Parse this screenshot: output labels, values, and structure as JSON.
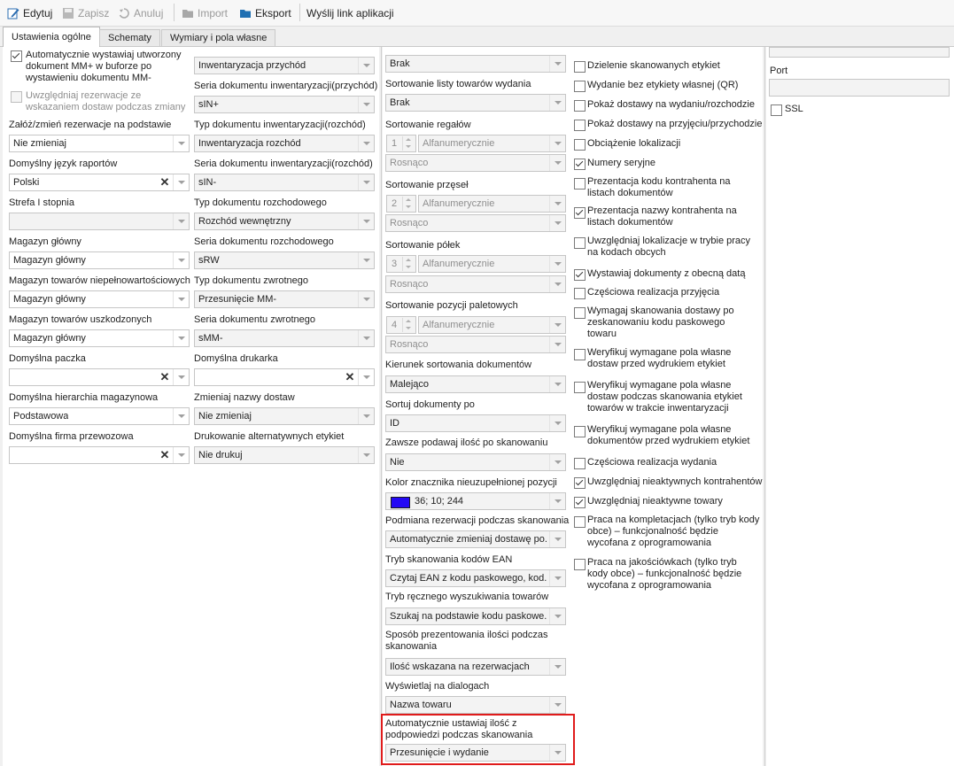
{
  "toolbar": {
    "edit": "Edytuj",
    "save": "Zapisz",
    "cancel": "Anuluj",
    "import": "Import",
    "export": "Eksport",
    "send_link": "Wyślij link aplikacji"
  },
  "tabs": [
    "Ustawienia ogólne",
    "Schematy",
    "Wymiary i pola własne"
  ],
  "col1": {
    "auto_mm_checkbox": "Automatycznie wystawiaj utworzony dokument MM+ w buforze po wystawieniu dokumentu MM-",
    "reservations_checkbox": "Uwzględniaj rezerwacje ze wskazaniem dostaw podczas zmiany",
    "fields": [
      {
        "label": "Załóż/zmień rezerwacje na podstawie",
        "value": "Nie zmieniaj"
      },
      {
        "label": "Domyślny język raportów",
        "value": "Polski"
      },
      {
        "label": "Strefa I stopnia",
        "value": ""
      },
      {
        "label": "Magazyn główny",
        "value": "Magazyn główny"
      },
      {
        "label": "Magazyn towarów niepełnowartościowych",
        "value": "Magazyn główny"
      },
      {
        "label": "Magazyn towarów uszkodzonych",
        "value": "Magazyn główny"
      },
      {
        "label": "Domyślna paczka",
        "value": ""
      },
      {
        "label": "Domyślna hierarchia magazynowa",
        "value": "Podstawowa"
      },
      {
        "label": "Domyślna firma przewozowa",
        "value": ""
      }
    ]
  },
  "col2": {
    "top_value": "Inwentaryzacja przychód",
    "fields": [
      {
        "label": "Seria dokumentu inwentaryzacji(przychód)",
        "value": "sIN+"
      },
      {
        "label": "Typ dokumentu inwentaryzacji(rozchód)",
        "value": "Inwentaryzacja rozchód"
      },
      {
        "label": "Seria dokumentu inwentaryzacji(rozchód)",
        "value": "sIN-"
      },
      {
        "label": "Typ dokumentu rozchodowego",
        "value": "Rozchód wewnętrzny"
      },
      {
        "label": "Seria dokumentu rozchodowego",
        "value": "sRW"
      },
      {
        "label": "Typ dokumentu zwrotnego",
        "value": "Przesunięcie MM-"
      },
      {
        "label": "Seria dokumentu zwrotnego",
        "value": "sMM-"
      },
      {
        "label": "Domyślna drukarka",
        "value": ""
      },
      {
        "label": "Zmieniaj nazwy dostaw",
        "value": "Nie zmieniaj"
      },
      {
        "label": "Drukowanie alternatywnych etykiet",
        "value": "Nie drukuj"
      }
    ]
  },
  "col3": {
    "top_value": "Brak",
    "sorting_issue": {
      "label": "Sortowanie listy towarów wydania",
      "value": "Brak"
    },
    "sort_groups": [
      {
        "label": "Sortowanie regałów",
        "num": "1",
        "mode": "Alfanumerycznie",
        "order": "Rosnąco"
      },
      {
        "label": "Sortowanie przęseł",
        "num": "2",
        "mode": "Alfanumerycznie",
        "order": "Rosnąco"
      },
      {
        "label": "Sortowanie półek",
        "num": "3",
        "mode": "Alfanumerycznie",
        "order": "Rosnąco"
      },
      {
        "label": "Sortowanie pozycji paletowych",
        "num": "4",
        "mode": "Alfanumerycznie",
        "order": "Rosnąco"
      }
    ],
    "fields": [
      {
        "label": "Kierunek sortowania dokumentów",
        "value": "Malejąco"
      },
      {
        "label": "Sortuj dokumenty po",
        "value": "ID"
      },
      {
        "label": "Zawsze podawaj ilość po skanowaniu",
        "value": "Nie"
      },
      {
        "label": "Kolor znacznika nieuzupełnionej pozycji",
        "value": "36; 10; 244"
      },
      {
        "label": "Podmiana rezerwacji podczas skanowania",
        "value": "Automatycznie zmieniaj dostawę po..."
      },
      {
        "label": "Tryb skanowania kodów EAN",
        "value": "Czytaj EAN z kodu paskowego, kod..."
      },
      {
        "label": "Tryb ręcznego wyszukiwania towarów",
        "value": "Szukaj na podstawie kodu paskowe..."
      },
      {
        "label": "Sposób prezentowania ilości podczas skanowania",
        "value": "Ilość wskazana na rezerwacjach"
      },
      {
        "label": "Wyświetlaj na dialogach",
        "value": "Nazwa towaru"
      },
      {
        "label": "Automatycznie ustawiaj ilość z podpowiedzi podczas skanowania",
        "value": "Przesunięcie i wydanie"
      }
    ],
    "marker_color": "#2409f4"
  },
  "col4": {
    "checkboxes": [
      {
        "label": "Dzielenie skanowanych etykiet",
        "checked": false
      },
      {
        "label": "Wydanie bez etykiety własnej (QR)",
        "checked": false
      },
      {
        "label": "Pokaż dostawy na wydaniu/rozchodzie",
        "checked": false
      },
      {
        "label": "Pokaż dostawy na przyjęciu/przychodzie",
        "checked": false
      },
      {
        "label": "Obciążenie lokalizacji",
        "checked": false
      },
      {
        "label": "Numery seryjne",
        "checked": true
      },
      {
        "label": "Prezentacja kodu kontrahenta na listach dokumentów",
        "checked": false
      },
      {
        "label": "Prezentacja nazwy kontrahenta na listach dokumentów",
        "checked": true
      },
      {
        "label": "Uwzględniaj lokalizacje w trybie pracy na kodach obcych",
        "checked": false
      },
      {
        "label": "Wystawiaj dokumenty z obecną datą",
        "checked": true
      },
      {
        "label": "Częściowa realizacja przyjęcia",
        "checked": false
      },
      {
        "label": "Wymagaj skanowania dostawy po zeskanowaniu kodu paskowego towaru",
        "checked": false
      },
      {
        "label": "Weryfikuj wymagane pola własne dostaw przed wydrukiem etykiet",
        "checked": false
      },
      {
        "label": "Weryfikuj wymagane pola własne dostaw podczas skanowania etykiet towarów w trakcie inwentaryzacji",
        "checked": false
      },
      {
        "label": "Weryfikuj wymagane pola własne dokumentów przed wydrukiem etykiet",
        "checked": false
      },
      {
        "label": "Częściowa realizacja wydania",
        "checked": false
      },
      {
        "label": "Uwzględniaj nieaktywnych kontrahentów",
        "checked": true
      },
      {
        "label": "Uwzględniaj nieaktywne towary",
        "checked": true
      },
      {
        "label": "Praca na kompletacjach (tylko tryb kody obce) – funkcjonalność będzie wycofana z oprogramowania",
        "checked": false
      },
      {
        "label": "Praca na jakościówkach (tylko tryb kody obce) – funkcjonalność będzie wycofana z oprogramowania",
        "checked": false
      }
    ]
  },
  "col5": {
    "port_label": "Port",
    "ssl_label": "SSL"
  },
  "highlight_color": "#e01b1b"
}
